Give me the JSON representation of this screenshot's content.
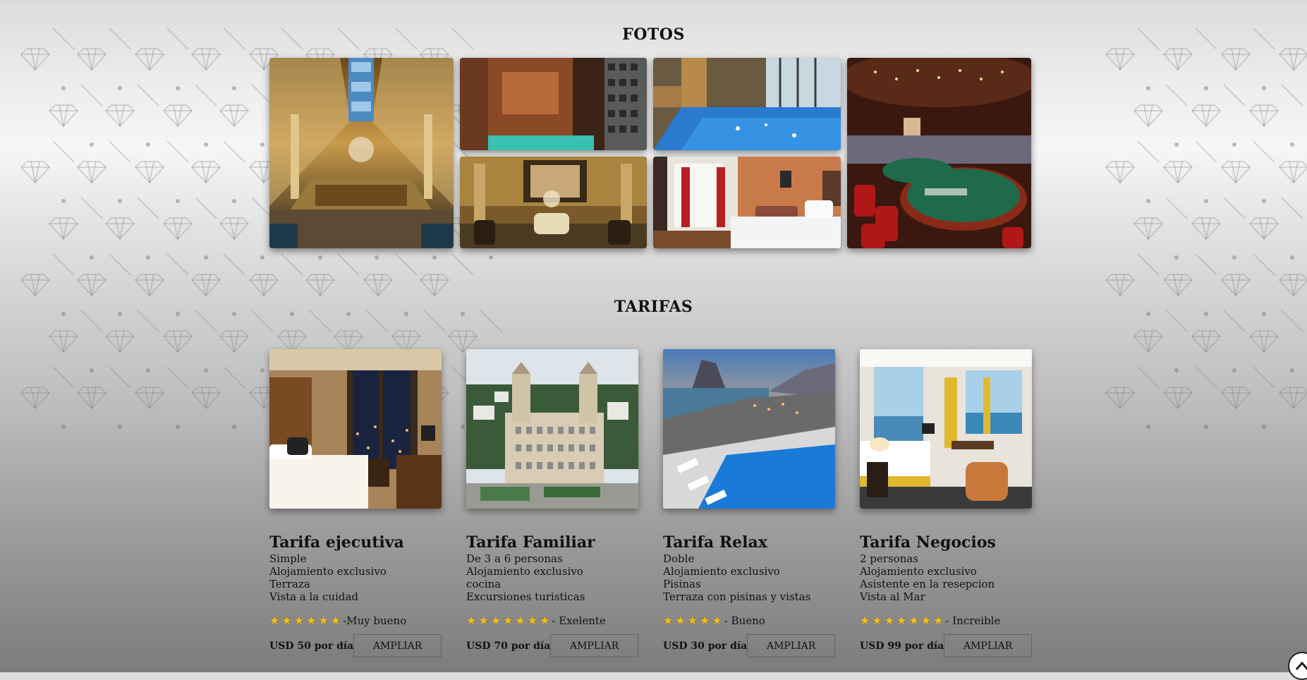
{
  "photos_section": {
    "title": "FOTOS",
    "photos": [
      {
        "name": "lobby-photo",
        "alt": "Hotel lobby"
      },
      {
        "name": "spa-photo",
        "alt": "Spa"
      },
      {
        "name": "pool-photo",
        "alt": "Indoor pool"
      },
      {
        "name": "casino-photo",
        "alt": "Casino"
      },
      {
        "name": "lounge-photo",
        "alt": "Lounge"
      },
      {
        "name": "bedroom-photo",
        "alt": "Bedroom"
      }
    ]
  },
  "rates_section": {
    "title": "TARIFAS",
    "cards": [
      {
        "title": "Tarifa ejecutiva",
        "features": [
          "Simple",
          "Alojamiento exclusivo",
          "Terraza",
          "Vista a la cuidad"
        ],
        "stars": 6,
        "rating_label": "-Muy bueno",
        "price": "USD 50 por día",
        "button": "AMPLIAR"
      },
      {
        "title": "Tarifa Familiar",
        "features": [
          "De 3 a 6 personas",
          "Alojamiento exclusivo",
          "cocina",
          "Excursiones turisticas"
        ],
        "stars": 7,
        "rating_label": "- Exelente",
        "price": "USD 70 por día",
        "button": "AMPLIAR"
      },
      {
        "title": "Tarifa Relax",
        "features": [
          "Doble",
          "Alojamiento exclusivo",
          "Pisinas",
          "Terraza con pisinas y vistas"
        ],
        "stars": 5,
        "rating_label": "- Bueno",
        "price": "USD 30 por día",
        "button": "AMPLIAR"
      },
      {
        "title": "Tarifa Negocios",
        "features": [
          "2 personas",
          "Alojamiento exclusivo",
          "Asistente en la resepcion",
          "Vista al Mar"
        ],
        "stars": 7,
        "rating_label": "- Increible",
        "price": "USD 99 por día",
        "button": "AMPLIAR"
      }
    ]
  },
  "colors": {
    "star": "#f2c21b",
    "text": "#111111"
  },
  "icons": {
    "star": "star-icon",
    "scroll_top": "chevron-up-icon"
  }
}
